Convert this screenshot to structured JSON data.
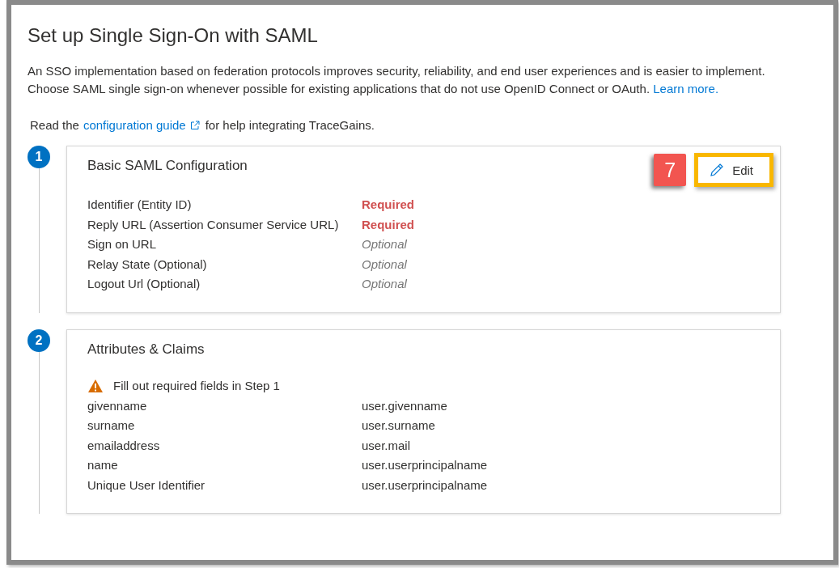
{
  "title": "Set up Single Sign-On with SAML",
  "intro": {
    "text": "An SSO implementation based on federation protocols improves security, reliability, and end user experiences and is easier to implement. Choose SAML single sign-on whenever possible for existing applications that do not use OpenID Connect or OAuth.",
    "link": "Learn more."
  },
  "guide": {
    "before": "Read the",
    "link": "configuration guide",
    "after": "for help integrating TraceGains."
  },
  "steps": [
    {
      "number": "1",
      "title": "Basic SAML Configuration",
      "callout": "7",
      "edit_button": {
        "label": "Edit",
        "highlighted": true
      },
      "rows": [
        {
          "label": "Identifier (Entity ID)",
          "value": "Required",
          "kind": "required"
        },
        {
          "label": "Reply URL (Assertion Consumer Service URL)",
          "value": "Required",
          "kind": "required"
        },
        {
          "label": "Sign on URL",
          "value": "Optional",
          "kind": "optional"
        },
        {
          "label": "Relay State (Optional)",
          "value": "Optional",
          "kind": "optional"
        },
        {
          "label": "Logout Url (Optional)",
          "value": "Optional",
          "kind": "optional"
        }
      ]
    },
    {
      "number": "2",
      "title": "Attributes & Claims",
      "warning": "Fill out required fields in Step 1",
      "rows": [
        {
          "label": "givenname",
          "value": "user.givenname",
          "kind": "plain"
        },
        {
          "label": "surname",
          "value": "user.surname",
          "kind": "plain"
        },
        {
          "label": "emailaddress",
          "value": "user.mail",
          "kind": "plain"
        },
        {
          "label": "name",
          "value": "user.userprincipalname",
          "kind": "plain"
        },
        {
          "label": "Unique User Identifier",
          "value": "user.userprincipalname",
          "kind": "plain"
        }
      ]
    }
  ]
}
